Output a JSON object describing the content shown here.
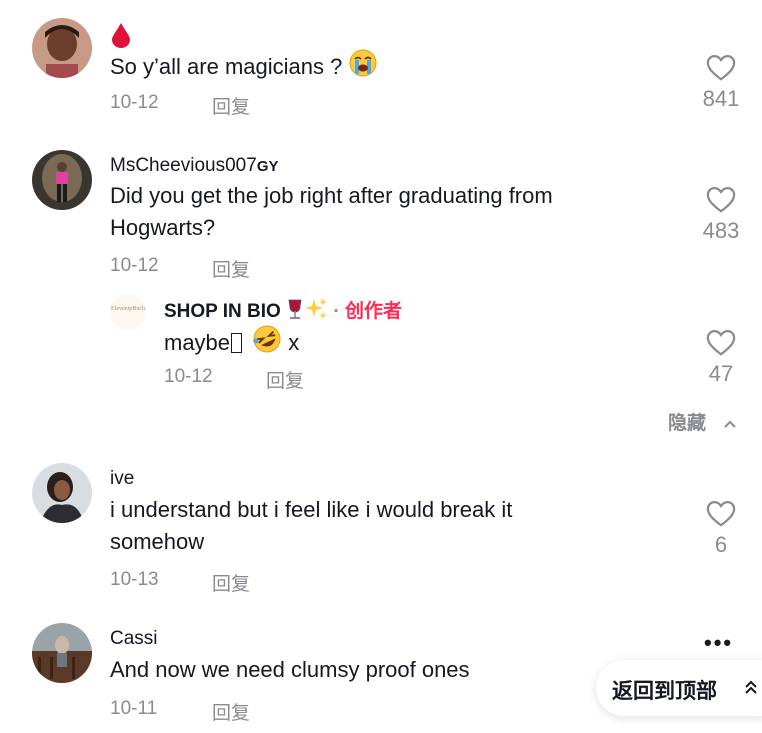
{
  "comments": [
    {
      "username": "",
      "text": "So y’all are magicians ?",
      "date": "10-12",
      "reply_label": "回复",
      "likes": "841"
    },
    {
      "username": "MsCheevious007",
      "username_suffix": "GY",
      "text_line1": "Did you get the job right after graduating from",
      "text_line2": "Hogwarts?",
      "date": "10-12",
      "reply_label": "回复",
      "likes": "483",
      "reply": {
        "username": "SHOP IN BIO",
        "separator": "·",
        "creator_label": "创作者",
        "avatar_text": "EleventyBuch",
        "text_before": "maybe",
        "text_after": " x",
        "date": "10-12",
        "reply_label": "回复",
        "likes": "47"
      }
    },
    {
      "username": "ive",
      "text_line1": "i understand but i feel like i would break it",
      "text_line2": "somehow",
      "date": "10-13",
      "reply_label": "回复",
      "likes": "6"
    },
    {
      "username": "Cassi",
      "text": "And now we need clumsy proof ones",
      "date": "10-11",
      "reply_label": "回复"
    }
  ],
  "hide_label": "隐藏",
  "more_label": "•••",
  "back_to_top_label": "返回到顶部",
  "colors": {
    "creator": "#fe2c55",
    "muted": "#8a8b91",
    "text": "#161823",
    "blood_drop": "#e0103a"
  }
}
